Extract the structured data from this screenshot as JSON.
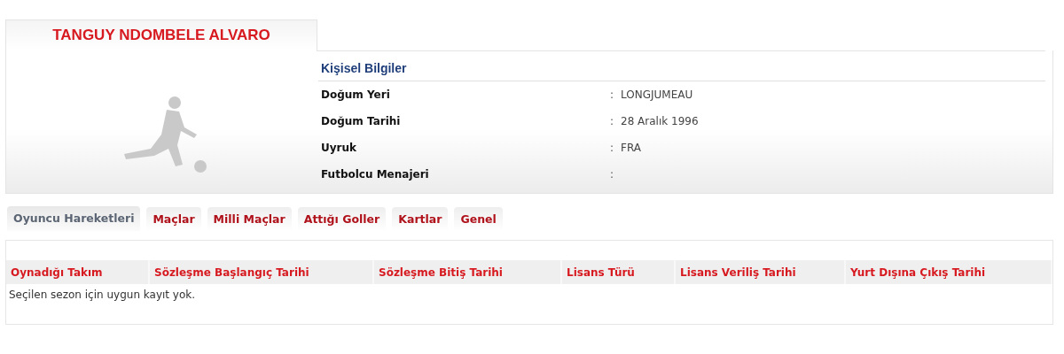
{
  "player": {
    "name": "TANGUY NDOMBELE ALVARO"
  },
  "personal_info": {
    "title": "Kişisel Bilgiler",
    "rows": [
      {
        "label": "Doğum Yeri",
        "separator": ":",
        "value": "LONGJUMEAU"
      },
      {
        "label": "Doğum Tarihi",
        "separator": ":",
        "value": "28 Aralık 1996"
      },
      {
        "label": "Uyruk",
        "separator": ":",
        "value": "FRA"
      },
      {
        "label": "Futbolcu Menajeri",
        "separator": ":"
      }
    ]
  },
  "tabs": [
    {
      "label": "Oyuncu Hareketleri",
      "selected": true
    },
    {
      "label": "Maçlar",
      "selected": false
    },
    {
      "label": "Milli Maçlar",
      "selected": false
    },
    {
      "label": "Attığı Goller",
      "selected": false
    },
    {
      "label": "Kartlar",
      "selected": false
    },
    {
      "label": "Genel",
      "selected": false
    }
  ],
  "table": {
    "columns": [
      "Oynadığı Takım",
      "Sözleşme Başlangıç Tarihi",
      "Sözleşme Bitiş Tarihi",
      "Lisans Türü",
      "Lisans Veriliş Tarihi",
      "Yurt Dışına Çıkış Tarihi"
    ],
    "empty_message": "Seçilen sezon için uygun kayıt yok."
  }
}
